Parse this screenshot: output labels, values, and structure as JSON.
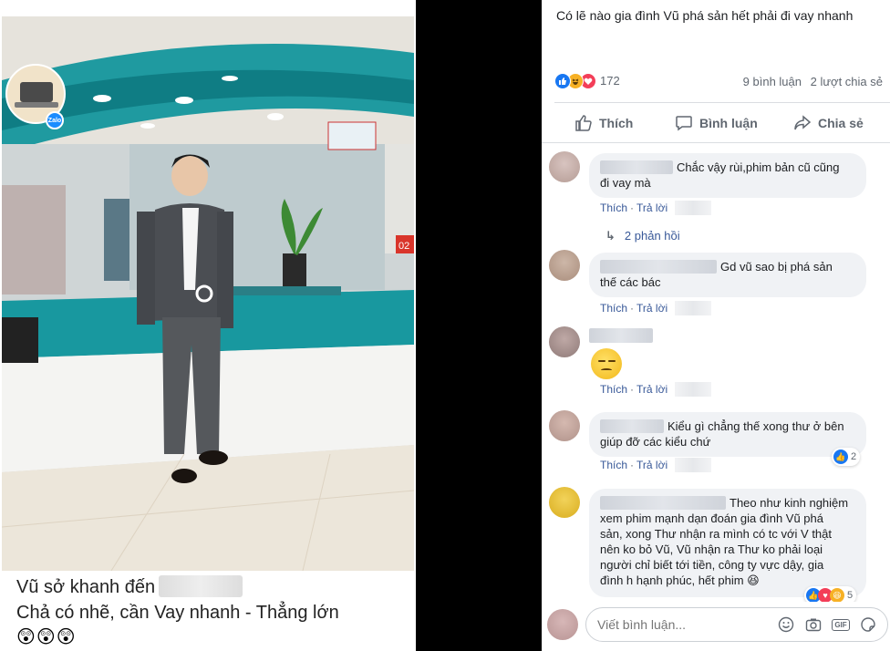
{
  "post": {
    "text": "Có lẽ nào gia đình Vũ phá sản hết phải đi vay nhanh",
    "reaction_count": "172",
    "comment_count": "9 bình luận",
    "share_count": "2 lượt chia sẻ",
    "reaction_icons": [
      "like-icon",
      "haha-icon",
      "love-icon"
    ]
  },
  "actions": {
    "like": "Thích",
    "comment": "Bình luận",
    "share": "Chia sẻ"
  },
  "caption": {
    "line1": "Vũ sở khanh đến",
    "line2": "Chả có nhẽ, cần Vay nhanh - Thẳng lớn",
    "emojis": "😲😲😲"
  },
  "photo": {
    "logo_badge": "Zalo",
    "counter_number": "02"
  },
  "comments": [
    {
      "text_line1": "Chắc vậy rùi,phim bản cũ cũng",
      "text_line2": "đi vay mà",
      "like": "Thích",
      "reply": "Trả lời",
      "replies_link": "2 phản hồi"
    },
    {
      "text_line1": "Gd vũ sao bị phá sản",
      "text_line2": "thế các bác",
      "like": "Thích",
      "reply": "Trả lời"
    },
    {
      "sticker": "disappointed-face",
      "like": "Thích",
      "reply": "Trả lời"
    },
    {
      "text_line1": "Kiểu gì chẳng thế xong thư ở bên",
      "text_line2": "giúp đỡ các kiểu chứ",
      "like": "Thích",
      "reply": "Trả lời",
      "reaction_count": "2"
    },
    {
      "text_lines": [
        "Theo như kinh nghiệm",
        "xem phim mạnh dạn đoán gia đình Vũ phá",
        "sản, xong Thư nhận ra mình có tc với V thật",
        "nên ko bỏ Vũ, Vũ nhận ra Thư ko phải loại",
        "người chỉ biết tới tiền, công ty vực dậy, gia",
        "đình h hạnh phúc, hết phim 😆"
      ],
      "reaction_count": "5"
    }
  ],
  "comment_input": {
    "placeholder": "Viết bình luận..."
  },
  "colors": {
    "facebook_blue": "#1877f2",
    "link_blue": "#385898",
    "bubble_bg": "#f0f2f5",
    "muted_text": "#606770"
  }
}
